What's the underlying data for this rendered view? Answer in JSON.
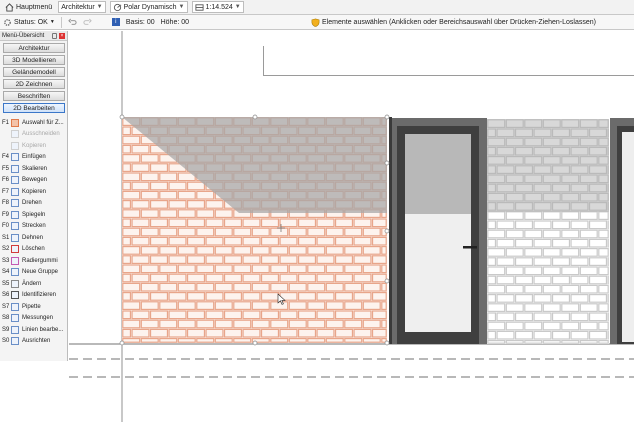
{
  "toolbar": {
    "main_menu": "Hauptmenü",
    "workspace": "Architektur",
    "snap_mode": "Polar Dynamisch",
    "scale": "1:14.524"
  },
  "statusbar": {
    "status_label": "Status: OK",
    "base_label": "Basis: 00",
    "height_label": "Höhe: 00",
    "hint": "Elemente auswählen (Anklicken oder Bereichsauswahl über Drücken-Ziehen-Loslassen)"
  },
  "panel": {
    "title": "Menü-Übersicht",
    "modes": [
      "Architektur",
      "3D Modellieren",
      "Geländemodell",
      "2D Zeichnen",
      "Beschriften",
      "2D Bearbeiten"
    ],
    "active_mode": "2D Bearbeiten",
    "tools": [
      {
        "key": "F1",
        "label": "Auswahl für Z...",
        "icon": "selection-icon",
        "enabled": true
      },
      {
        "key": "",
        "label": "Ausschneiden",
        "icon": "cut-icon",
        "enabled": false
      },
      {
        "key": "",
        "label": "Kopieren",
        "icon": "copy-icon",
        "enabled": false
      },
      {
        "key": "F4",
        "label": "Einfügen",
        "icon": "paste-icon",
        "enabled": true
      },
      {
        "key": "F5",
        "label": "Skalieren",
        "icon": "scale-icon",
        "enabled": true
      },
      {
        "key": "F6",
        "label": "Bewegen",
        "icon": "move-icon",
        "enabled": true
      },
      {
        "key": "F7",
        "label": "Kopieren",
        "icon": "copy-icon",
        "enabled": true
      },
      {
        "key": "F8",
        "label": "Drehen",
        "icon": "rotate-icon",
        "enabled": true
      },
      {
        "key": "F9",
        "label": "Spiegeln",
        "icon": "mirror-icon",
        "enabled": true
      },
      {
        "key": "F0",
        "label": "Strecken",
        "icon": "stretch-icon",
        "enabled": true
      },
      {
        "key": "S1",
        "label": "Dehnen",
        "icon": "extend-icon",
        "enabled": true
      },
      {
        "key": "S2",
        "label": "Löschen",
        "icon": "delete-icon",
        "enabled": true
      },
      {
        "key": "S3",
        "label": "Radiergummi",
        "icon": "eraser-icon",
        "enabled": true
      },
      {
        "key": "S4",
        "label": "Neue Gruppe",
        "icon": "group-icon",
        "enabled": true
      },
      {
        "key": "S5",
        "label": "Ändern",
        "icon": "modify-icon",
        "enabled": true
      },
      {
        "key": "S6",
        "label": "Identifizieren",
        "icon": "identify-icon",
        "enabled": true
      },
      {
        "key": "S7",
        "label": "Pipette",
        "icon": "pipette-icon",
        "enabled": true
      },
      {
        "key": "S8",
        "label": "Messungen",
        "icon": "measure-icon",
        "enabled": true
      },
      {
        "key": "S9",
        "label": "Linien bearbe...",
        "icon": "line-edit-icon",
        "enabled": true
      },
      {
        "key": "S0",
        "label": "Ausrichten",
        "icon": "align-icon",
        "enabled": true
      }
    ]
  },
  "colors": {
    "selected_brick": "#e8a58a",
    "grey_brick": "#c9c9c9",
    "shadow": "#a8a8a8",
    "frame": "#3a3a3a",
    "accent": "#3b77c9"
  }
}
